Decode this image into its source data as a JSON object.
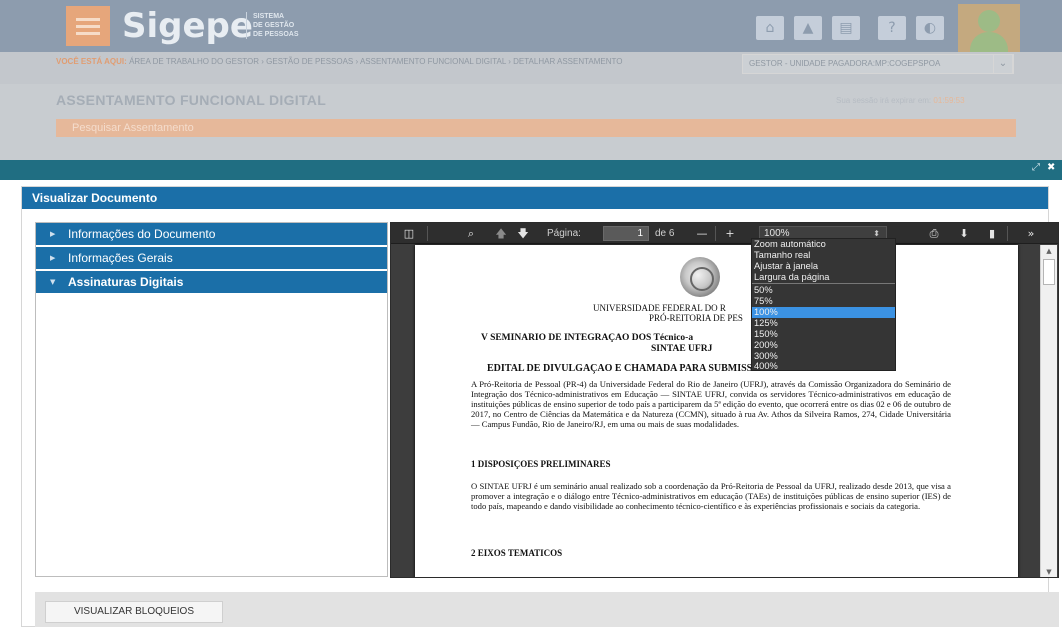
{
  "app": {
    "logo": "Sigepe",
    "logo_sub": [
      "SISTEMA",
      "DE GESTÃO",
      "DE PESSOAS"
    ],
    "icons": [
      "home-icon",
      "bell-icon",
      "book-icon",
      "help-icon",
      "contrast-icon"
    ]
  },
  "breadcrumb": {
    "prefix": "VOCÊ ESTÁ AQUI:",
    "path": "ÁREA DE TRABALHO DO GESTOR › GESTÃO DE PESSOAS › ASSENTAMENTO FUNCIONAL DIGITAL › DETALHAR ASSENTAMENTO"
  },
  "profile": {
    "value": "GESTOR - UNIDADE PAGADORA:MP:COGEPSPOA"
  },
  "page": {
    "title": "ASSENTAMENTO FUNCIONAL DIGITAL",
    "session_text": "Sua sessão irá expirar em:",
    "session_time": "01:59:53",
    "search_bar": "Pesquisar Assentamento"
  },
  "modal": {
    "title": "Visualizar Documento",
    "accordion": [
      {
        "label": "Informações do Documento",
        "open": false
      },
      {
        "label": "Informações Gerais",
        "open": false
      },
      {
        "label": "Assinaturas Digitais",
        "open": true
      }
    ],
    "footer_button": "VISUALIZAR BLOQUEIOS"
  },
  "viewer": {
    "page_label": "Página:",
    "page_value": "1",
    "page_total": "de 6",
    "zoom_value": "100%",
    "zoom_options": [
      "Zoom automático",
      "Tamanho real",
      "Ajustar à janela",
      "Largura da página",
      "50%",
      "75%",
      "100%",
      "125%",
      "150%",
      "200%",
      "300%",
      "400%"
    ],
    "zoom_selected": "100%"
  },
  "document": {
    "univ_line": "UNIVERSIDADE FEDERAL DO R",
    "pro_line": "PRÓ-REITORIA DE PES",
    "seminar_line": "V SEMINARIO DE INTEGRAÇAO DOS Técnico-a",
    "sintae_line": "SINTAE UFRJ",
    "edital_line": "EDITAL DE DIVULGAÇAO E CHAMADA PARA SUBMISSAO DE TRABALHOS",
    "para1": "A Pró-Reitoria de Pessoal (PR-4) da Universidade Federal do Rio de Janeiro (UFRJ), através da Comissão Organizadora do Seminário de Integração dos Técnico-administrativos em Educação — SINTAE UFRJ, convida os servidores Técnico-administrativos em educação de instituições públicas de ensino superior de todo país a participarem da 5ª edição do evento, que ocorrerá entre os dias 02 e 06 de outubro de 2017, no Centro de Ciências da Matemática e da Natureza (CCMN), situado à rua Av. Athos da Silveira Ramos, 274, Cidade Universitária — Campus Fundão, Rio de Janeiro/RJ, em uma ou mais de suas modalidades.",
    "h1": "1 DISPOSIÇOES PRELIMINARES",
    "para2": "O SINTAE UFRJ é um seminário anual realizado sob a coordenação da Pró-Reitoria de Pessoal da UFRJ, realizado desde 2013, que visa a promover a integração e o diálogo entre Técnico-administrativos em educação (TAEs) de instituições públicas de ensino superior (IES) de todo país, mapeando e dando visibilidade ao conhecimento técnico-científico e às experiências profissionais e sociais da categoria.",
    "h2": "2 EIXOS TEMATICOS"
  },
  "colors": {
    "primary_blue": "#1b6fa8",
    "modal_bar": "#206e82",
    "accent_orange": "#e6a67b",
    "zoom_highlight": "#3b92e3"
  }
}
